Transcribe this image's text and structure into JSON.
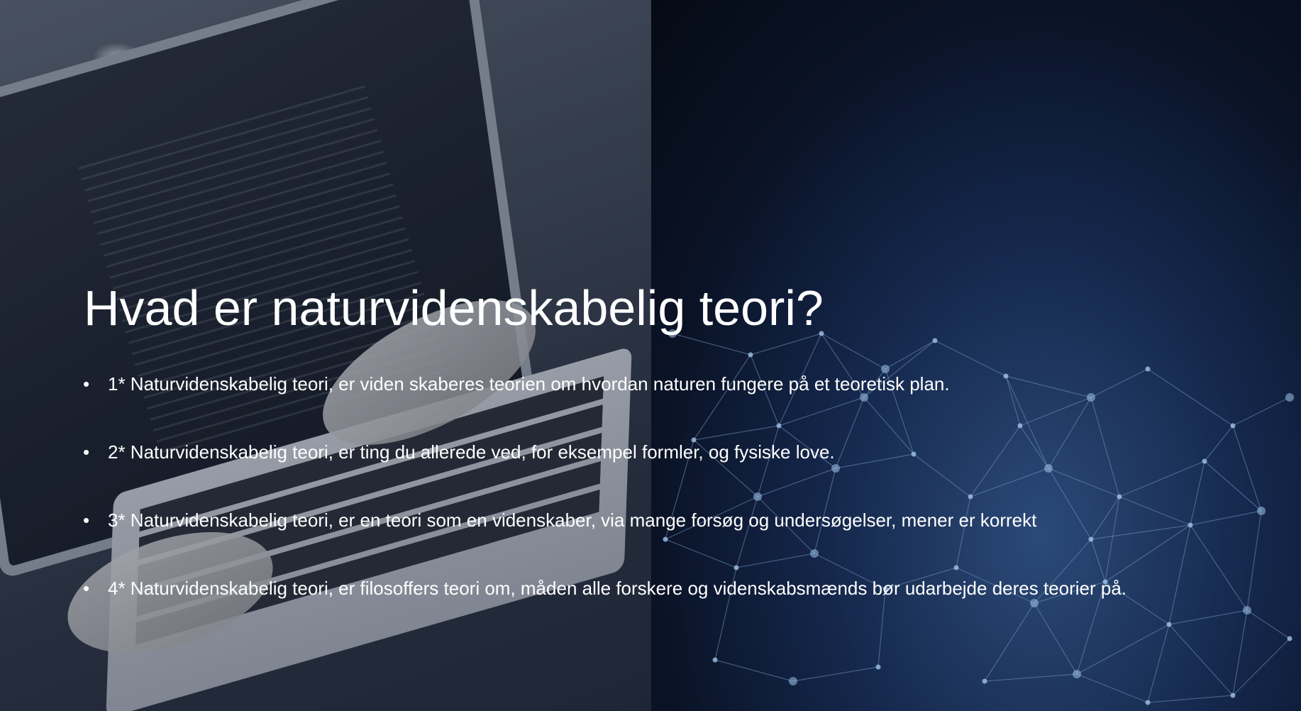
{
  "slide": {
    "title": "Hvad er naturvidenskabelig teori?",
    "bullet_char": "•",
    "bullets": [
      {
        "text": "1* Naturvidenskabelig teori, er viden skaberes teorien om hvordan naturen fungere på et teoretisk plan."
      },
      {
        "text": "2* Naturvidenskabelig teori, er ting du allerede ved, for eksempel formler, og fysiske love."
      },
      {
        "text": "3* Naturvidenskabelig teori, er en teori som en videnskaber, via mange forsøg og undersøgelser, mener er korrekt"
      },
      {
        "text": "4* Naturvidenskabelig teori, er filosoffers teori om, måden alle forskere og videnskabsmænds bør udarbejde deres teorier på."
      }
    ]
  },
  "colors": {
    "text": "#ffffff",
    "network_node": "#9fc3ea",
    "network_line": "#6f8fb8"
  }
}
